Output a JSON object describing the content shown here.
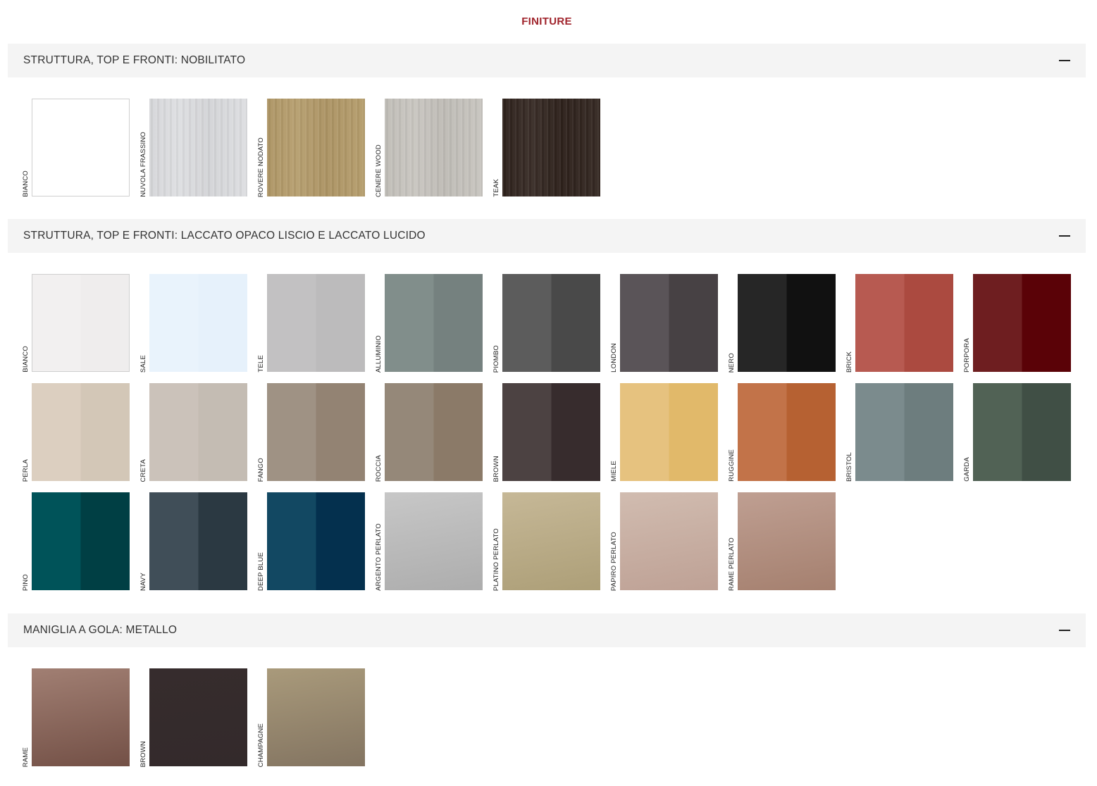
{
  "page_title": "FINITURE",
  "sections": [
    {
      "title": "STRUTTURA, TOP E FRONTI: NOBILITATO",
      "toggle_icon": "minus-icon",
      "swatches": [
        {
          "label": "BIANCO",
          "color": "#ffffff",
          "finish": "plain"
        },
        {
          "label": "NUVOLA FRASSINO",
          "color": "#dcdde0",
          "finish": "wood"
        },
        {
          "label": "ROVERE NODATO",
          "color": "#b39a68",
          "finish": "wood"
        },
        {
          "label": "CENERE WOOD",
          "color": "#c6c3bd",
          "finish": "wood"
        },
        {
          "label": "TEAK",
          "color": "#2f221c",
          "finish": "wood"
        }
      ]
    },
    {
      "title": "STRUTTURA, TOP E FRONTI: LACCATO OPACO LISCIO E LACCATO LUCIDO",
      "toggle_icon": "minus-icon",
      "swatches": [
        {
          "label": "BIANCO",
          "color": "#f2f0f0",
          "color2": "#efeded",
          "finish": "split"
        },
        {
          "label": "SALE",
          "color": "#e9f3fc",
          "color2": "#e6f1fb",
          "finish": "split"
        },
        {
          "label": "TELE",
          "color": "#c2c1c2",
          "color2": "#bcbbbc",
          "finish": "split"
        },
        {
          "label": "ALLUMINIO",
          "color": "#818e8b",
          "color2": "#75817f",
          "finish": "split"
        },
        {
          "label": "PIOMBO",
          "color": "#5c5c5c",
          "color2": "#494949",
          "finish": "split"
        },
        {
          "label": "LONDON",
          "color": "#5a5458",
          "color2": "#474144",
          "finish": "split"
        },
        {
          "label": "NERO",
          "color": "#262626",
          "color2": "#111111",
          "finish": "split"
        },
        {
          "label": "BRICK",
          "color": "#b75a51",
          "color2": "#ab4a40",
          "finish": "split"
        },
        {
          "label": "PORPORA",
          "color": "#6e1e20",
          "color2": "#5a0207",
          "finish": "split"
        },
        {
          "label": "PERLA",
          "color": "#dccfc0",
          "color2": "#d3c7b7",
          "finish": "split"
        },
        {
          "label": "CRETA",
          "color": "#cbc2ba",
          "color2": "#c4bcb3",
          "finish": "split"
        },
        {
          "label": "FANGO",
          "color": "#9f9284",
          "color2": "#938373",
          "finish": "split"
        },
        {
          "label": "ROCCIA",
          "color": "#958879",
          "color2": "#8b7a68",
          "finish": "split"
        },
        {
          "label": "BROWN",
          "color": "#4c4242",
          "color2": "#372c2d",
          "finish": "split"
        },
        {
          "label": "MIELE",
          "color": "#e6c27f",
          "color2": "#e1b96a",
          "finish": "split"
        },
        {
          "label": "RUGGINE",
          "color": "#c27349",
          "color2": "#b66132",
          "finish": "split"
        },
        {
          "label": "BRISTOL",
          "color": "#7b8b8d",
          "color2": "#6d7d7e",
          "finish": "split"
        },
        {
          "label": "GARDA",
          "color": "#516255",
          "color2": "#404f45",
          "finish": "split"
        },
        {
          "label": "PINO",
          "color": "#005359",
          "color2": "#003f44",
          "finish": "split"
        },
        {
          "label": "NAVY",
          "color": "#404e58",
          "color2": "#2b3942",
          "finish": "split"
        },
        {
          "label": "DEEP BLUE",
          "color": "#124862",
          "color2": "#04304e",
          "finish": "split"
        },
        {
          "label": "ARGENTO PERLATO",
          "color": "#c7c7c7",
          "color2": "#adadad",
          "finish": "metallic"
        },
        {
          "label": "PLATINO PERLATO",
          "color": "#c6b897",
          "color2": "#ad9f78",
          "finish": "metallic"
        },
        {
          "label": "PAPIRO PERLATO",
          "color": "#d1bcb0",
          "color2": "#bea195",
          "finish": "metallic"
        },
        {
          "label": "RAME PERLATO",
          "color": "#bf9f92",
          "color2": "#a5806f",
          "finish": "metallic"
        }
      ]
    },
    {
      "title": "MANIGLIA A GOLA: METALLO",
      "toggle_icon": "minus-icon",
      "swatches": [
        {
          "label": "RAME",
          "color": "#a17f73",
          "color2": "#735046",
          "finish": "metallic"
        },
        {
          "label": "BROWN",
          "color": "#362c2d",
          "color2": "#332a2b",
          "finish": "metallic"
        },
        {
          "label": "CHAMPAGNE",
          "color": "#a99a7b",
          "color2": "#837461",
          "finish": "metallic"
        }
      ]
    }
  ]
}
